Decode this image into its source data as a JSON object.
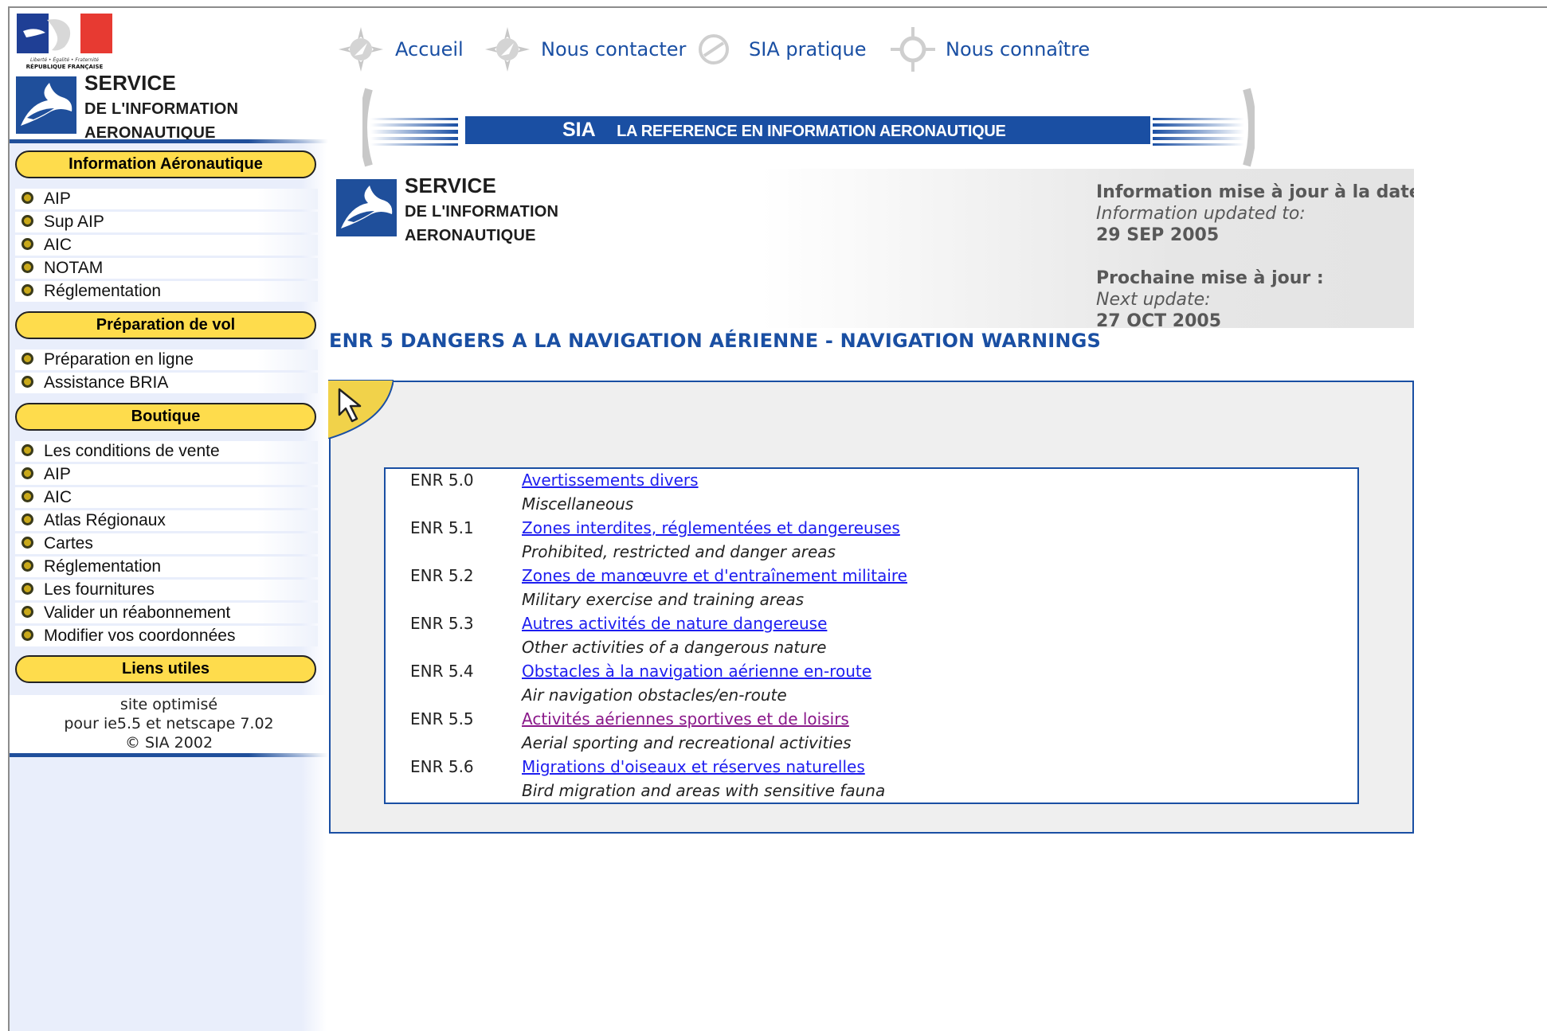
{
  "brand": {
    "republic_motto": "Liberté • Égalité • Fraternité",
    "republic_name": "RÉPUBLIQUE FRANÇAISE",
    "service_line1": "SERVICE",
    "service_line2": "DE L'INFORMATION",
    "service_line3": "AERONAUTIQUE"
  },
  "top_nav": [
    {
      "label": "Accueil"
    },
    {
      "label": "Nous contacter"
    },
    {
      "label": "SIA pratique"
    },
    {
      "label": "Nous connaître"
    }
  ],
  "banner": {
    "sia": "SIA",
    "tagline": "LA REFERENCE EN INFORMATION AERONAUTIQUE"
  },
  "sidebar": {
    "sections": [
      {
        "title": "Information Aéronautique",
        "items": [
          "AIP",
          "Sup AIP",
          "AIC",
          "NOTAM",
          "Réglementation"
        ]
      },
      {
        "title": "Préparation de vol",
        "items": [
          "Préparation en ligne",
          "Assistance BRIA"
        ]
      },
      {
        "title": "Boutique",
        "items": [
          "Les conditions de vente",
          "AIP",
          "AIC",
          "Atlas Régionaux",
          "Cartes",
          "Réglementation",
          "Les fournitures",
          "Valider un réabonnement",
          "Modifier vos coordonnées"
        ]
      },
      {
        "title": "Liens utiles",
        "items": []
      }
    ],
    "footer": {
      "line1": "site optimisé",
      "line2": "pour ie5.5 et netscape 7.02",
      "line3": "© SIA 2002"
    }
  },
  "update_info": {
    "label_fr": "Information mise à jour à la date :",
    "label_en": "Information updated to:",
    "date": "29 SEP 2005",
    "next_fr": "Prochaine mise à jour :",
    "next_en": "Next update:",
    "next_date": "27 OCT 2005"
  },
  "page_title": "ENR 5 DANGERS A LA NAVIGATION AÉRIENNE - NAVIGATION WARNINGS",
  "enr_rows": [
    {
      "code": "ENR 5.0",
      "title_fr": "Avertissements divers",
      "title_en": "Miscellaneous",
      "visited": false
    },
    {
      "code": "ENR 5.1",
      "title_fr": "Zones interdites, réglementées et dangereuses",
      "title_en": "Prohibited, restricted and danger areas",
      "visited": false
    },
    {
      "code": "ENR 5.2",
      "title_fr": "Zones de manœuvre et d'entraînement militaire",
      "title_en": "Military exercise and training areas",
      "visited": false
    },
    {
      "code": "ENR 5.3",
      "title_fr": "Autres activités de nature dangereuse",
      "title_en": "Other activities of a dangerous nature",
      "visited": false
    },
    {
      "code": "ENR 5.4",
      "title_fr": "Obstacles à la navigation aérienne en-route",
      "title_en": "Air navigation obstacles/en-route",
      "visited": false
    },
    {
      "code": "ENR 5.5",
      "title_fr": "Activités aériennes sportives et de loisirs",
      "title_en": "Aerial sporting and recreational activities",
      "visited": true
    },
    {
      "code": "ENR 5.6",
      "title_fr": "Migrations d'oiseaux et réserves naturelles",
      "title_en": "Bird migration and areas with sensitive fauna",
      "visited": false
    }
  ],
  "colors": {
    "accent_blue": "#1a4fa3",
    "pill_yellow": "#fedc4c",
    "link": "#1d1df0",
    "visited_link": "#8a188a",
    "panel_grey": "#efefef"
  }
}
